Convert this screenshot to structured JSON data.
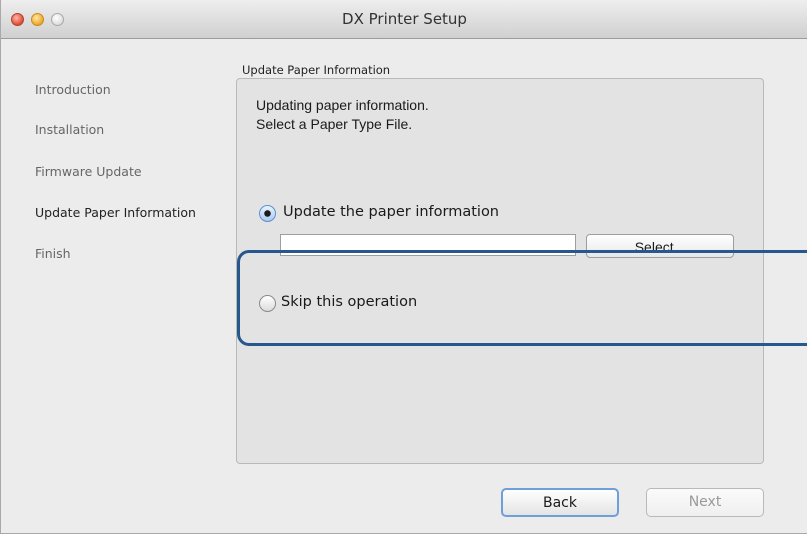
{
  "window": {
    "title": "DX Printer Setup"
  },
  "sidebar": {
    "items": [
      {
        "label": "Introduction",
        "current": false
      },
      {
        "label": "Installation",
        "current": false
      },
      {
        "label": "Firmware Update",
        "current": false
      },
      {
        "label": "Update Paper Information",
        "current": true
      },
      {
        "label": "Finish",
        "current": false
      }
    ]
  },
  "main": {
    "group_title": "Update Paper Information",
    "instruction_line1": "Updating paper information.",
    "instruction_line2": "Select a Paper Type File.",
    "options": [
      {
        "label": "Update the paper information",
        "selected": true
      },
      {
        "label": "Skip this operation",
        "selected": false
      }
    ],
    "file_path_value": "",
    "select_button_label": "Select..."
  },
  "footer": {
    "back_label": "Back",
    "next_label": "Next",
    "next_enabled": false
  },
  "colors": {
    "highlight": "#26578d",
    "default_button_border": "#6f9fd8"
  }
}
